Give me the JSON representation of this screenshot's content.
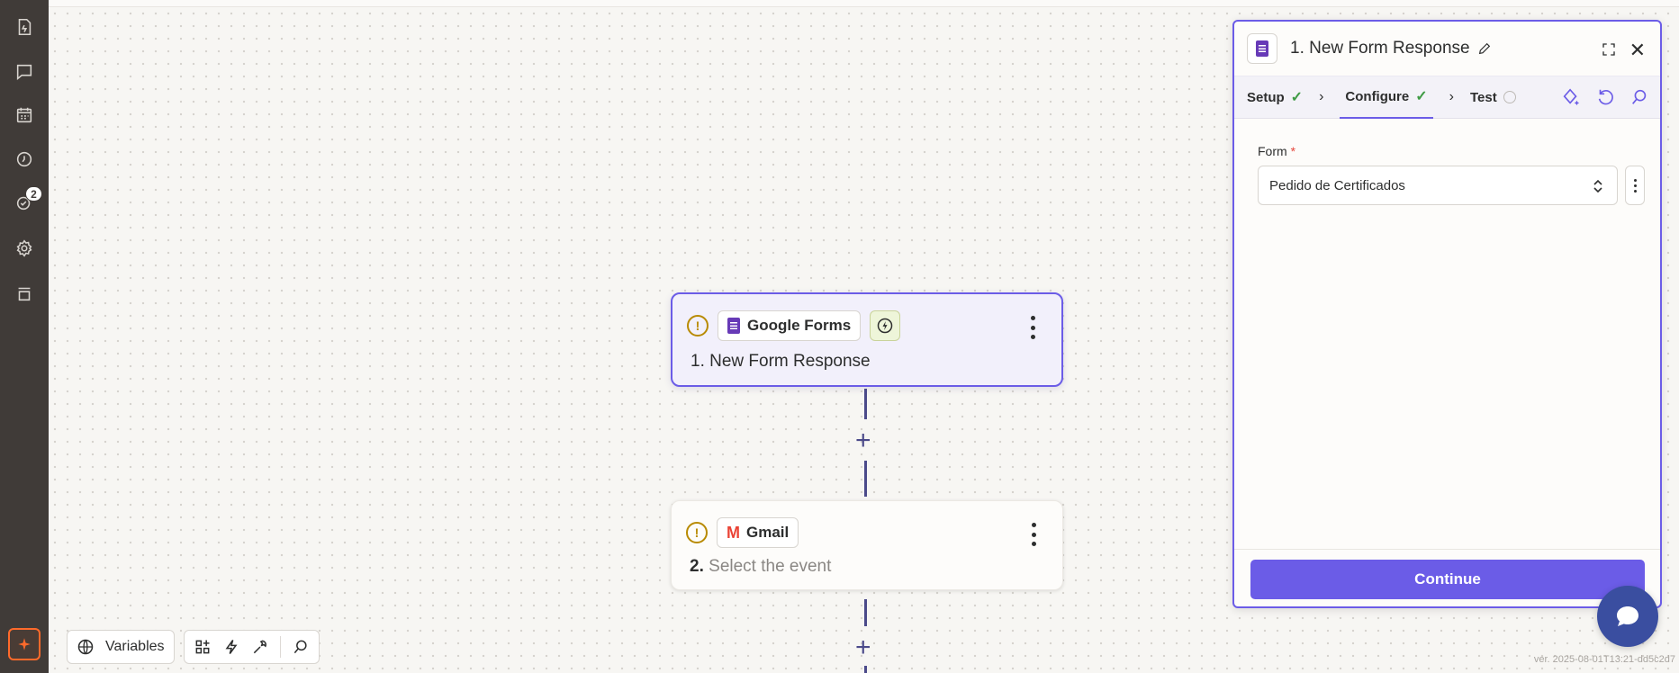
{
  "sidebar": {
    "items": [
      {
        "name": "zaps-icon"
      },
      {
        "name": "chat-icon"
      },
      {
        "name": "calendar-icon"
      },
      {
        "name": "history-icon"
      },
      {
        "name": "alerts-icon",
        "badge": "2"
      },
      {
        "name": "settings-icon"
      },
      {
        "name": "templates-icon"
      }
    ],
    "ai_button_icon": "sparkle-icon"
  },
  "steps": [
    {
      "app": "Google Forms",
      "title_number": "1.",
      "title": "New Form Response",
      "status": "warning",
      "trigger": true
    },
    {
      "app": "Gmail",
      "title_number": "2.",
      "title": "Select the event",
      "status": "warning"
    }
  ],
  "panel": {
    "title": "1. New Form Response",
    "tabs": [
      {
        "label": "Setup",
        "status": "done"
      },
      {
        "label": "Configure",
        "status": "done"
      },
      {
        "label": "Test",
        "status": "pending"
      }
    ],
    "field_label": "Form",
    "field_required": "*",
    "field_value": "Pedido de Certificados",
    "continue_label": "Continue"
  },
  "toolbar": {
    "variables_label": "Variables"
  },
  "version": "ver. 2025-08-01T13:21-dd5c2d7",
  "colors": {
    "accent": "#6b5ce7",
    "rail": "#403b38",
    "forms_purple": "#673ab7",
    "gmail_red": "#ea4335",
    "warning": "#b88a00"
  }
}
